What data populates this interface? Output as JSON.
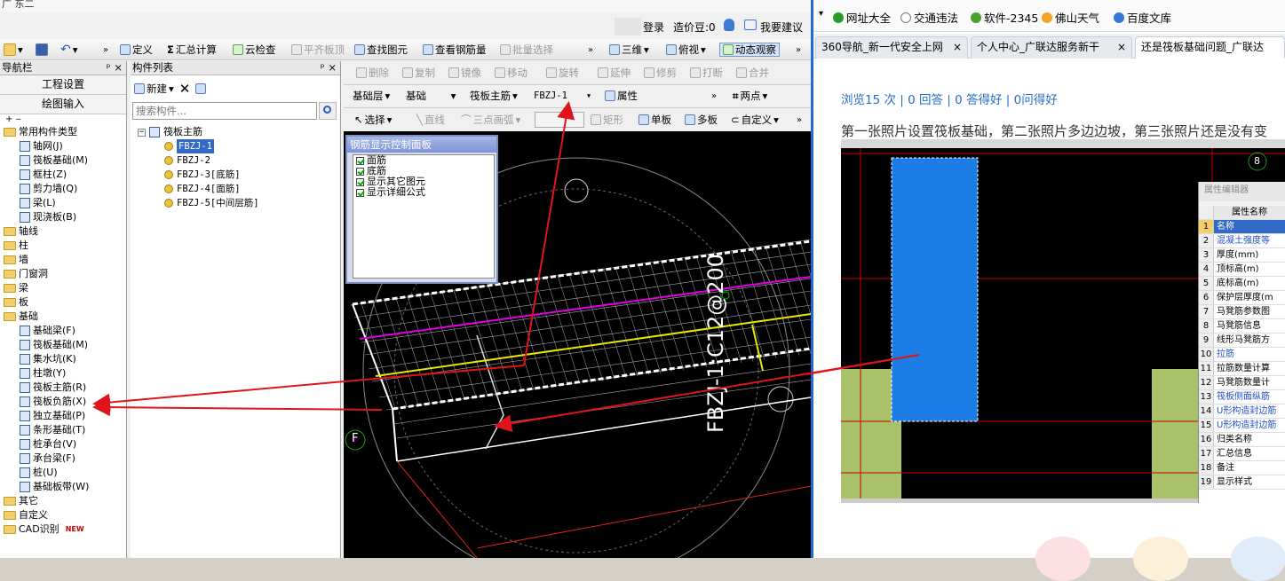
{
  "app": {
    "title": "广 东二",
    "login_label": "登录",
    "price_label": "造价豆:0",
    "suggest_label": "我要建议",
    "toolbar": [
      {
        "label": "定义",
        "enabled": true
      },
      {
        "label": "汇总计算",
        "enabled": true
      },
      {
        "label": "云检查",
        "enabled": true
      },
      {
        "label": "平齐板顶",
        "enabled": false
      },
      {
        "label": "查找图元",
        "enabled": true
      },
      {
        "label": "查看钢筋量",
        "enabled": true
      },
      {
        "label": "批量选择",
        "enabled": false
      },
      {
        "label": "三维",
        "enabled": true
      },
      {
        "label": "俯视",
        "enabled": true
      },
      {
        "label": "动态观察",
        "enabled": true
      }
    ],
    "edit_toolbar": [
      "删除",
      "复制",
      "镜像",
      "移动",
      "旋转",
      "延伸",
      "修剪",
      "打断",
      "合并"
    ],
    "layer_selectors": {
      "level": "基础层",
      "category": "基础",
      "type": "筏板主筋",
      "item": "FBZJ-1",
      "props_label": "属性",
      "twopoint_label": "两点"
    },
    "draw_toolbar": [
      "选择",
      "直线",
      "三点画弧",
      "矩形",
      "单板",
      "多板",
      "自定义"
    ]
  },
  "nav": {
    "title": "导航栏",
    "buttons": [
      "工程设置",
      "绘图输入"
    ],
    "tree": [
      {
        "label": "常用构件类型",
        "kind": "folder",
        "level": 0
      },
      {
        "label": "轴网(J)",
        "kind": "leaf",
        "level": 1
      },
      {
        "label": "筏板基础(M)",
        "kind": "leaf",
        "level": 1
      },
      {
        "label": "框柱(Z)",
        "kind": "leaf",
        "level": 1
      },
      {
        "label": "剪力墙(Q)",
        "kind": "leaf",
        "level": 1
      },
      {
        "label": "梁(L)",
        "kind": "leaf",
        "level": 1
      },
      {
        "label": "现浇板(B)",
        "kind": "leaf",
        "level": 1
      },
      {
        "label": "轴线",
        "kind": "folder",
        "level": 0
      },
      {
        "label": "柱",
        "kind": "folder",
        "level": 0
      },
      {
        "label": "墙",
        "kind": "folder",
        "level": 0
      },
      {
        "label": "门窗洞",
        "kind": "folder",
        "level": 0
      },
      {
        "label": "梁",
        "kind": "folder",
        "level": 0
      },
      {
        "label": "板",
        "kind": "folder",
        "level": 0
      },
      {
        "label": "基础",
        "kind": "folder",
        "level": 0
      },
      {
        "label": "基础梁(F)",
        "kind": "leaf",
        "level": 1
      },
      {
        "label": "筏板基础(M)",
        "kind": "leaf",
        "level": 1
      },
      {
        "label": "集水坑(K)",
        "kind": "leaf",
        "level": 1
      },
      {
        "label": "柱墩(Y)",
        "kind": "leaf",
        "level": 1
      },
      {
        "label": "筏板主筋(R)",
        "kind": "leaf",
        "level": 1
      },
      {
        "label": "筏板负筋(X)",
        "kind": "leaf",
        "level": 1
      },
      {
        "label": "独立基础(P)",
        "kind": "leaf",
        "level": 1
      },
      {
        "label": "条形基础(T)",
        "kind": "leaf",
        "level": 1
      },
      {
        "label": "桩承台(V)",
        "kind": "leaf",
        "level": 1
      },
      {
        "label": "承台梁(F)",
        "kind": "leaf",
        "level": 1
      },
      {
        "label": "桩(U)",
        "kind": "leaf",
        "level": 1
      },
      {
        "label": "基础板带(W)",
        "kind": "leaf",
        "level": 1
      },
      {
        "label": "其它",
        "kind": "folder",
        "level": 0
      },
      {
        "label": "自定义",
        "kind": "folder",
        "level": 0
      },
      {
        "label": "CAD识别",
        "kind": "folder",
        "level": 0
      }
    ],
    "new_badge": "NEW"
  },
  "components": {
    "title": "构件列表",
    "new_label": "新建",
    "search_placeholder": "搜索构件...",
    "root": "筏板主筋",
    "items": [
      "FBZJ-1",
      "FBZJ-2",
      "FBZJ-3[底筋]",
      "FBZJ-4[面筋]",
      "FBZJ-5[中间层筋]"
    ],
    "selected": "FBZJ-1"
  },
  "control_panel": {
    "title": "钢筋显示控制面板",
    "options": [
      {
        "label": "面筋",
        "checked": true
      },
      {
        "label": "底筋",
        "checked": true
      },
      {
        "label": "显示其它图元",
        "checked": true
      },
      {
        "label": "显示详细公式",
        "checked": true
      }
    ]
  },
  "viewport": {
    "rebar_label": "FBZJ-1:C12@200",
    "axis_f": "F"
  },
  "browser": {
    "bookmarks": [
      "网址大全",
      "交通违法",
      "软件-2345",
      "佛山天气",
      "百度文库"
    ],
    "tabs": [
      {
        "label": "360导航_新一代安全上网",
        "active": false
      },
      {
        "label": "个人中心_广联达服务新干",
        "active": false
      },
      {
        "label": "还是筏板基础问题_广联达",
        "active": true
      }
    ],
    "stats": "浏览15 次 | 0 回答 | 0 答得好 | 0问得好",
    "question": "第一张照片设置筏板基础，第二张照片多边边坡，第三张照片还是没有变",
    "prop_editor": {
      "title": "属性编辑器",
      "header": "属性名称",
      "rows": [
        "名称",
        "混凝土强度等",
        "厚度(mm)",
        "顶标高(m)",
        "底标高(m)",
        "保护层厚度(m",
        "马凳筋参数图",
        "马凳筋信息",
        "线形马凳筋方",
        "拉筋",
        "拉筋数量计算",
        "马凳筋数量计",
        "筏板侧面纵筋",
        "U形构造封边筋",
        "U形构造封边筋",
        "归类名称",
        "汇总信息",
        "备注",
        "显示样式"
      ]
    },
    "grid_label": "8"
  },
  "colors": {
    "accent": "#3169c6",
    "arrow": "#e0141b",
    "blue_slab": "#1d7de6",
    "green_wall": "#a9c168",
    "rebar_yellow": "#e8e800",
    "rebar_magenta": "#e000e0"
  }
}
